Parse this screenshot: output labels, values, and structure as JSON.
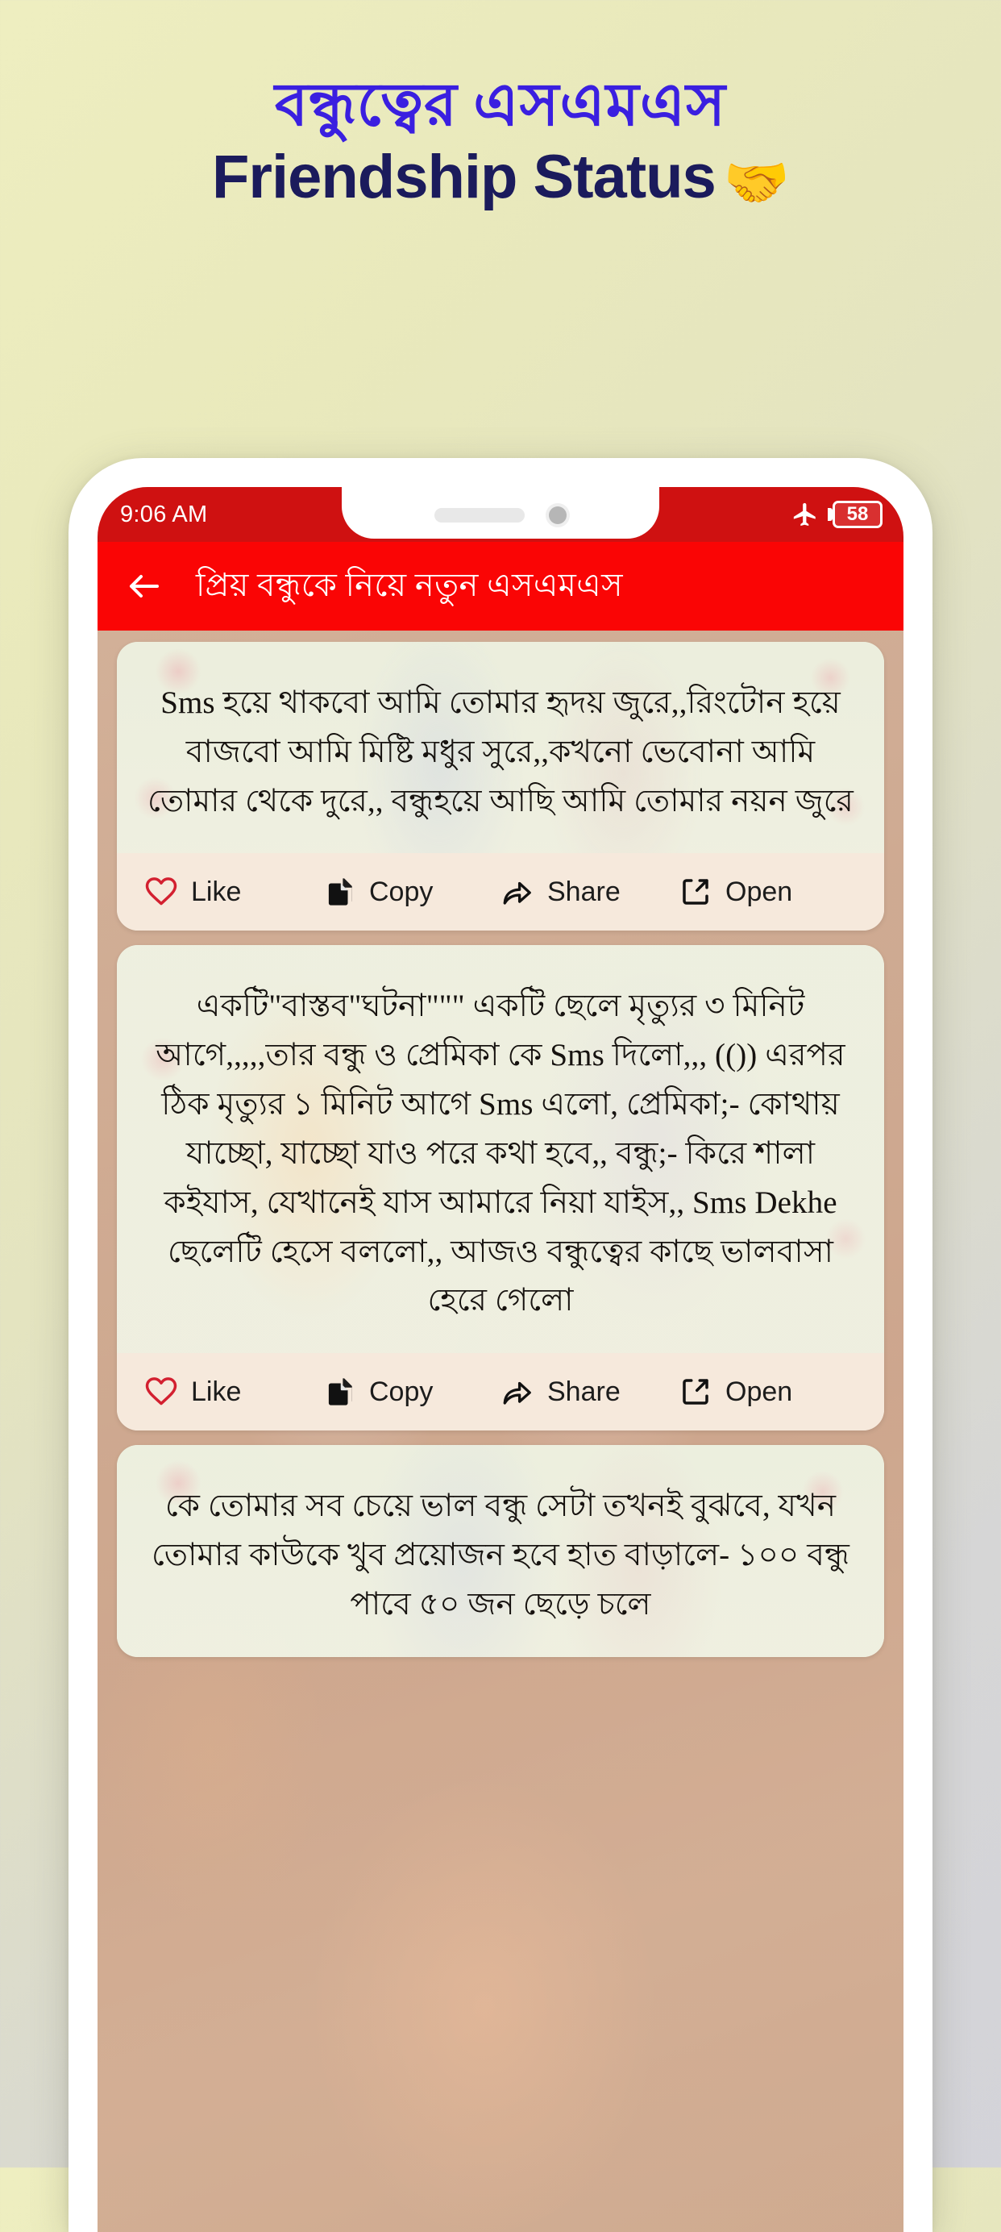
{
  "promo": {
    "title_bn": "বন্ধুত্বের এসএমএস",
    "title_en": "Friendship Status",
    "emoji": "🤝"
  },
  "phone": {
    "statusbar": {
      "time": "9:06 AM",
      "airplane_icon": "airplane-mode-icon",
      "battery_level": "58"
    },
    "appbar": {
      "back_icon": "back-arrow-icon",
      "title": "প্রিয় বন্ধুকে নিয়ে নতুন এসএমএস"
    },
    "actions": {
      "like": "Like",
      "copy": "Copy",
      "share": "Share",
      "open": "Open",
      "like_icon": "heart-icon",
      "copy_icon": "copy-document-icon",
      "share_icon": "share-arrow-icon",
      "open_icon": "open-external-icon"
    },
    "cards": [
      {
        "text": "Sms হয়ে থাকবো আমি তোমার হৃদয় জুরে,,রিংটোন হয়ে বাজবো আমি মিষ্টি মধুর সুরে,,কখনো ভেবোনা আমি তোমার থেকে দুরে,, বন্ধুহয়ে আছি আমি তোমার নয়ন জুরে"
      },
      {
        "text": "একটি\"বাস্তব\"ঘটনা\"\"\" একটি ছেলে মৃত্যুর ৩ মিনিট আগে,,,,,তার বন্ধু ও প্রেমিকা কে Sms দিলো,,, (()) এরপর ঠিক মৃত্যুর ১ মিনিট আগে Sms এলো, প্রেমিকা;- কোথায় যাচ্ছো, যাচ্ছো যাও পরে কথা হবে,, বন্ধু;- কিরে শালা কইযাস, যেখানেই যাস আমারে নিয়া যাইস,, Sms Dekhe ছেলেটি হেসে বললো,, আজও বন্ধুত্বের কাছে ভালবাসা হেরে গেলো"
      },
      {
        "text": "কে তোমার সব চেয়ে ভাল বন্ধু সেটা তখনই বুঝবে, যখন তোমার কাউকে খুব প্রয়োজন হবে হাত বাড়ালে- ১০০ বন্ধু পাবে ৫০ জন ছেড়ে চলে"
      }
    ]
  },
  "colors": {
    "appbar_red": "#fa0505",
    "statusbar_red": "#cf1111",
    "heart_red": "#d32030",
    "promo_blue": "#3a1fe0",
    "promo_navy": "#1b1b5c"
  }
}
